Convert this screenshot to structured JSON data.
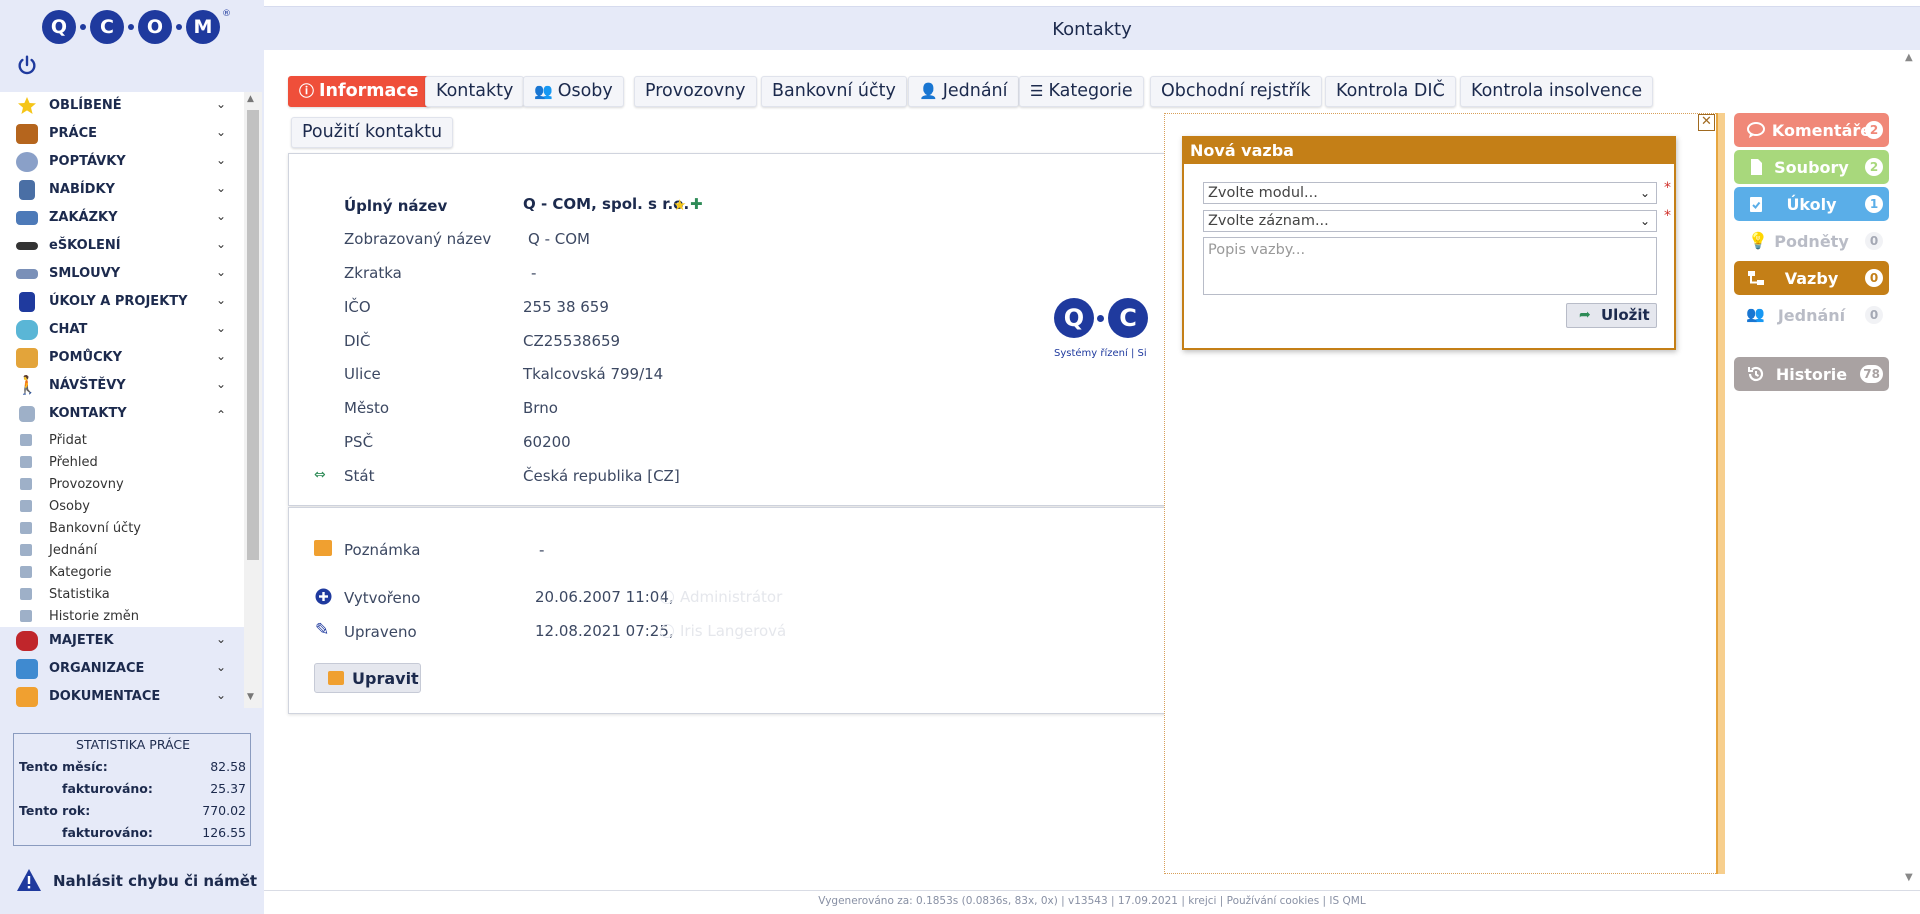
{
  "app": {
    "logo_text": "Q·COM",
    "logo_letters": [
      "Q",
      "C",
      "O",
      "M"
    ],
    "logo_reg": "®",
    "page_title": "Kontakty"
  },
  "sidebar": {
    "items": [
      {
        "label": "OBLÍBENÉ",
        "icon": "star-icon",
        "color": "#f5c518"
      },
      {
        "label": "PRÁCE",
        "icon": "briefcase-icon",
        "color": "#b5651d"
      },
      {
        "label": "POPTÁVKY",
        "icon": "lightbulb-icon",
        "color": "#8aa0c8"
      },
      {
        "label": "NABÍDKY",
        "icon": "clipboard-icon",
        "color": "#4a6fa5"
      },
      {
        "label": "ZAKÁZKY",
        "icon": "toolbox-icon",
        "color": "#4d7ab8"
      },
      {
        "label": "eŠKOLENÍ",
        "icon": "graduation-cap-icon",
        "color": "#333333"
      },
      {
        "label": "SMLOUVY",
        "icon": "handshake-icon",
        "color": "#7a90b8"
      },
      {
        "label": "ÚKOLY A PROJEKTY",
        "icon": "task-icon",
        "color": "#1f3a9e"
      },
      {
        "label": "CHAT",
        "icon": "chat-icon",
        "color": "#5ab6d6"
      },
      {
        "label": "POMŮCKY",
        "icon": "stack-icon",
        "color": "#e3a43a"
      },
      {
        "label": "NÁVŠTĚVY",
        "icon": "walking-icon",
        "color": "#1f3a9e"
      },
      {
        "label": "KONTAKTY",
        "icon": "contacts-icon",
        "color": "#9eb0c8",
        "expanded": true
      },
      {
        "label": "MAJETEK",
        "icon": "car-icon",
        "color": "#c0262b"
      },
      {
        "label": "ORGANIZACE",
        "icon": "cube-icon",
        "color": "#3f8ad0"
      },
      {
        "label": "DOKUMENTACE",
        "icon": "document-icon",
        "color": "#f0a030"
      }
    ],
    "sub_items": [
      "Přidat",
      "Přehled",
      "Provozovny",
      "Osoby",
      "Bankovní účty",
      "Jednání",
      "Kategorie",
      "Statistika",
      "Historie změn"
    ],
    "stats": {
      "title": "STATISTIKA PRÁCE",
      "month_label": "Tento měsíc:",
      "month_value": "82.58",
      "month_billed_label": "fakturováno:",
      "month_billed_value": "25.37",
      "year_label": "Tento rok:",
      "year_value": "770.02",
      "year_billed_label": "fakturováno:",
      "year_billed_value": "126.55"
    },
    "report_label": "Nahlásit chybu či námět"
  },
  "tabs": [
    {
      "label": "Informace",
      "icon": "info-icon",
      "active": true
    },
    {
      "label": "Kontakty"
    },
    {
      "label": "Osoby",
      "icon": "users-icon"
    },
    {
      "label": "Provozovny"
    },
    {
      "label": "Bankovní účty"
    },
    {
      "label": "Jednání",
      "icon": "person-tie-icon"
    },
    {
      "label": "Kategorie",
      "icon": "list-icon"
    },
    {
      "label": "Obchodní rejstřík"
    },
    {
      "label": "Kontrola DIČ"
    },
    {
      "label": "Kontrola insolvence"
    },
    {
      "label": "Použití kontaktu"
    }
  ],
  "info": {
    "full_name_label": "Úplný název",
    "full_name_value": "Q - COM, spol. s r.o.",
    "display_name_label": "Zobrazovaný název",
    "display_name_value": "Q - COM",
    "abbr_label": "Zkratka",
    "abbr_value": "-",
    "ico_label": "IČO",
    "ico_value": "255 38 659",
    "dic_label": "DIČ",
    "dic_value": "CZ25538659",
    "street_label": "Ulice",
    "street_value": "Tkalcovská 799/14",
    "city_label": "Město",
    "city_value": "Brno",
    "zip_label": "PSČ",
    "zip_value": "60200",
    "country_label": "Stát",
    "country_value": "Česká republika [CZ]",
    "company_logo_letters": "Q·C",
    "company_logo_tagline": "Systémy řízení  |  Si"
  },
  "meta": {
    "note_label": "Poznámka",
    "note_value": "-",
    "created_label": "Vytvořeno",
    "created_value": "20.06.2007 11:04,",
    "created_by": "Administrátor",
    "modified_label": "Upraveno",
    "modified_value": "12.08.2021 07:25,",
    "modified_by": "Iris Langerová",
    "edit_button": "Upravit"
  },
  "right_panel": [
    {
      "label": "Komentáře",
      "count": "2",
      "color": "#f08878",
      "icon": "comment-icon"
    },
    {
      "label": "Soubory",
      "count": "2",
      "color": "#a8d87c",
      "icon": "file-icon"
    },
    {
      "label": "Úkoly",
      "count": "1",
      "color": "#5aaee8",
      "icon": "task-check-icon"
    },
    {
      "label": "Podněty",
      "count": "0",
      "plain": true,
      "icon": "bulb-icon"
    },
    {
      "label": "Vazby",
      "count": "0",
      "color": "#c47f17",
      "icon": "sitemap-icon"
    },
    {
      "label": "Jednání",
      "count": "0",
      "plain": true,
      "icon": "group-icon"
    },
    {
      "label": "Historie",
      "count": "78",
      "color": "#a9a2a2",
      "icon": "history-icon"
    }
  ],
  "modal": {
    "title": "Nová vazba",
    "module_placeholder": "Zvolte modul...",
    "record_placeholder": "Zvolte záznam...",
    "description_placeholder": "Popis vazby...",
    "required_mark": "*",
    "save_label": "Uložit",
    "close_label": "✕"
  },
  "footer": {
    "text": "Vygenerováno za: 0.1853s (0.0836s, 83x, 0x) | v13543 | 17.09.2021 | krejci | Používání cookies | IS QML"
  }
}
